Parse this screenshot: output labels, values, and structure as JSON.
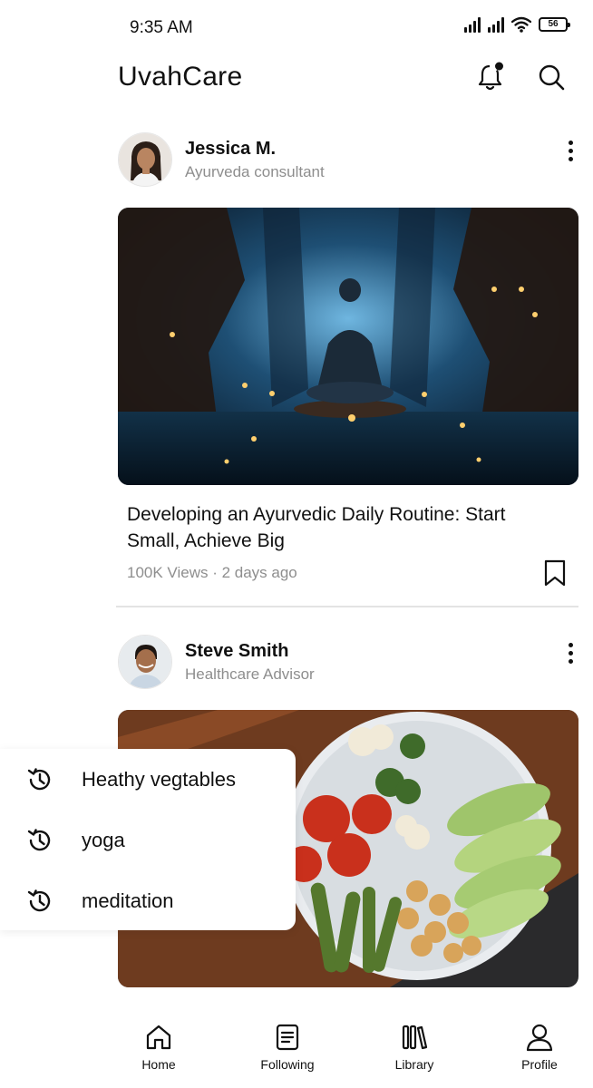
{
  "status_bar": {
    "time": "9:35 AM",
    "battery": "56"
  },
  "header": {
    "title": "UvahCare"
  },
  "posts": [
    {
      "author": "Jessica M.",
      "role": "Ayurveda consultant",
      "title": "Developing an Ayurvedic Daily Routine: Start Small, Achieve Big",
      "meta": "100K Views · 2 days ago"
    },
    {
      "author": "Steve Smith",
      "role": "Healthcare Advisor"
    }
  ],
  "search_history": [
    "Heathy vegtables",
    "yoga",
    "meditation"
  ],
  "nav": {
    "home": "Home",
    "following": "Following",
    "library": "Library",
    "profile": "Profile"
  },
  "colors": {
    "text": "#111111",
    "muted": "#8e8e8e",
    "divider": "#e3e3e3"
  }
}
